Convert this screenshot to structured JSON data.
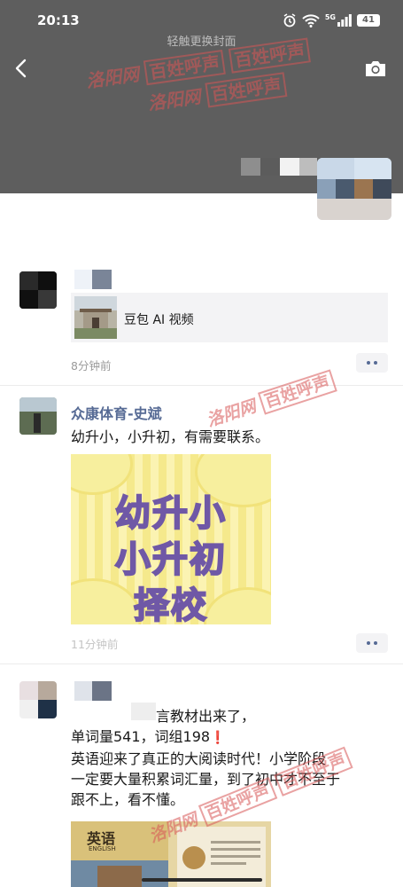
{
  "status_bar": {
    "time": "20:13",
    "network": "5G",
    "battery": "41",
    "icons": [
      "alarm-icon",
      "wifi-icon",
      "signal-icon",
      "battery-icon"
    ]
  },
  "cover": {
    "hint": "轻触更换封面",
    "watermark_top": [
      "洛阳网",
      "百姓呼声",
      "百姓呼声"
    ],
    "watermark_mid": [
      "洛阳网",
      "百姓呼声"
    ],
    "icons": [
      "back-icon",
      "camera-icon"
    ],
    "background_color": "#5e5e5e"
  },
  "posts": [
    {
      "link_card": {
        "title": "豆包 AI 视频"
      },
      "time": "8分钟前"
    },
    {
      "nickname": "众康体育-史斌",
      "text": "幼升小，小升初，有需要联系。",
      "image_text": [
        "幼升小",
        "小升初",
        "择校"
      ],
      "watermark": [
        "洛阳网",
        "百姓呼声"
      ],
      "time": "11分钟前"
    },
    {
      "text_lines": [
        "言教材出来了，",
        "单词量541，词组198",
        "英语迎来了真正的大阅读时代！小学阶段",
        "一定要大量积累词汇量，到了初中才不至于",
        "跟不上，看不懂。"
      ],
      "exclamation": "❗",
      "watermark": [
        "洛阳网",
        "百姓呼声",
        "百姓呼声"
      ],
      "book": {
        "title": "英语",
        "subtitle": "ENGLISH"
      }
    }
  ],
  "colors": {
    "nickname": "#576b95",
    "time": "#9a9a9a",
    "watermark": "#d75555"
  }
}
